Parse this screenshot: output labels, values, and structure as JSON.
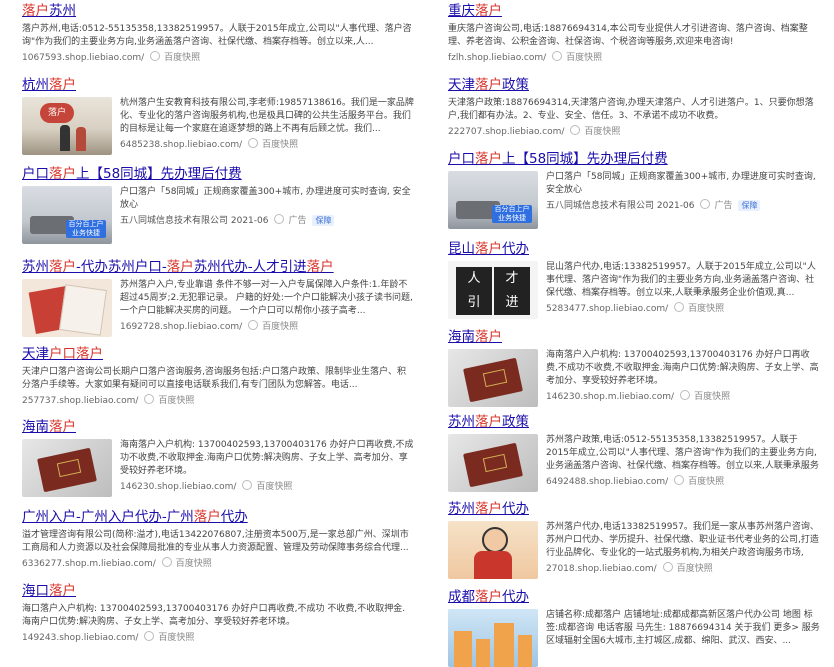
{
  "left": [
    {
      "title_segments": [
        {
          "t": "落户",
          "hl": true
        },
        {
          "t": "苏州",
          "hl": false
        }
      ],
      "snippet_segments": [
        {
          "t": "落户",
          "hl": true
        },
        {
          "t": "苏州,电话:0512-55135358,13382519957。人联于2015年成立,公司以\"人事代理、",
          "hl": false
        },
        {
          "t": "落户",
          "hl": true
        },
        {
          "t": "咨询\"作为我们的主要业务方向,业务涵盖",
          "hl": false
        },
        {
          "t": "落户",
          "hl": true
        },
        {
          "t": "咨询、社保代缴、档案存档等。创立以来,人...",
          "hl": false
        }
      ],
      "url": "1067593.shop.liebiao.com/",
      "snapshot": "百度快照"
    },
    {
      "title_segments": [
        {
          "t": "杭州",
          "hl": false
        },
        {
          "t": "落户",
          "hl": true
        }
      ],
      "thumb": "office",
      "thumb_text": "落户",
      "snippet_segments": [
        {
          "t": "杭州",
          "hl": false
        },
        {
          "t": "落户",
          "hl": true
        },
        {
          "t": "生安教育科技有限公司,李老师:19857138616。我们是一家品牌化、专业化的",
          "hl": false
        },
        {
          "t": "落户",
          "hl": true
        },
        {
          "t": "咨询服务机构,也是极具口碑的公共生活服务平台。我们的目标是让每一个家庭在追逐梦想的路上不再有后顾之忧。我们...",
          "hl": false
        }
      ],
      "url": "6485238.shop.liebiao.com/",
      "snapshot": "百度快照"
    },
    {
      "title_segments": [
        {
          "t": "户口",
          "hl": false
        },
        {
          "t": "落户",
          "hl": true
        },
        {
          "t": "上【58同城】先办理后付费",
          "hl": false
        }
      ],
      "thumb": "room",
      "thumb_text": "百分百上户 业务快捷",
      "snippet_segments": [
        {
          "t": "户口",
          "hl": false
        },
        {
          "t": "落户",
          "hl": true
        },
        {
          "t": "「58同城」正规商家覆盖300+城市, 办理进度可实时查询, 安全放心",
          "hl": false
        }
      ],
      "sub": "五八同城信息技术有限公司 2021-06",
      "ad": "广告",
      "guard": "保障"
    },
    {
      "title_segments": [
        {
          "t": "苏州",
          "hl": false
        },
        {
          "t": "落户",
          "hl": true
        },
        {
          "t": "-代办苏州户口-",
          "hl": false
        },
        {
          "t": "落户",
          "hl": true
        },
        {
          "t": "苏州代办-人才引进",
          "hl": false
        },
        {
          "t": "落户",
          "hl": true
        }
      ],
      "thumb": "docs",
      "snippet_segments": [
        {
          "t": "苏州",
          "hl": false
        },
        {
          "t": "落户",
          "hl": true
        },
        {
          "t": "入户,专业靠谱 条件不够一对一入户专属保障入户条件:1.年龄不超过45周岁;2.无犯罪记录。 户籍的好处:一个户口能解决小孩子读书问题,一个户口能解决买房的问题。 一个户口可以帮你小孩子高考...",
          "hl": false
        }
      ],
      "url": "1692728.shop.liebiao.com/",
      "snapshot": "百度快照"
    },
    {
      "title_segments": [
        {
          "t": "天津",
          "hl": false
        },
        {
          "t": "户口落户",
          "hl": true
        }
      ],
      "snippet_segments": [
        {
          "t": "天津户口",
          "hl": false
        },
        {
          "t": "落户",
          "hl": true
        },
        {
          "t": "咨询公司长期户口",
          "hl": false
        },
        {
          "t": "落户",
          "hl": true
        },
        {
          "t": "咨询服务,咨询服务包括:户口",
          "hl": false
        },
        {
          "t": "落户",
          "hl": true
        },
        {
          "t": "政策、限制毕业生",
          "hl": false
        },
        {
          "t": "落户",
          "hl": true
        },
        {
          "t": "、积分",
          "hl": false
        },
        {
          "t": "落户",
          "hl": true
        },
        {
          "t": "手续等。大家如果有疑问可以直接电话联系我们,有专门团队为您解答。电话...",
          "hl": false
        }
      ],
      "url": "257737.shop.liebiao.com/",
      "snapshot": "百度快照"
    },
    {
      "title_segments": [
        {
          "t": "海南",
          "hl": false
        },
        {
          "t": "落户",
          "hl": true
        }
      ],
      "thumb": "book",
      "snippet_segments": [
        {
          "t": "海南",
          "hl": false
        },
        {
          "t": "落户",
          "hl": true
        },
        {
          "t": "入户机构: 13700402593,13700403176 办好户口再收费,不成功不收费,不收取押金.海南户口优势:解决购房、子女上学、高考加分、享受较好养老环境。",
          "hl": false
        }
      ],
      "url": "146230.shop.liebiao.com/",
      "snapshot": "百度快照"
    },
    {
      "title_segments": [
        {
          "t": "广州入户-广州入户代办-广州",
          "hl": false
        },
        {
          "t": "落户",
          "hl": true
        },
        {
          "t": "代办",
          "hl": false
        }
      ],
      "snippet_segments": [
        {
          "t": "溢才管理咨询有限公司(简称:溢才),电话13422076807,注册资本500万,是一家总部广州、深圳市工商局和人力资源以及社会保障局批准的专业从事人力资源配置、管理及劳动保障事务综合代理...",
          "hl": false
        }
      ],
      "url": "6336277.shop.m.liebiao.com/",
      "snapshot": "百度快照"
    },
    {
      "title_segments": [
        {
          "t": "海口",
          "hl": false
        },
        {
          "t": "落户",
          "hl": true
        }
      ],
      "snippet_segments": [
        {
          "t": "海口",
          "hl": false
        },
        {
          "t": "落户",
          "hl": true
        },
        {
          "t": "入户机构: 13700402593,13700403176 办好户口再收费,不成功 不收费,不收取押金.海南户口优势:解决购房、子女上学、高考加分、享受较好养老环境。",
          "hl": false
        }
      ],
      "url": "149243.shop.liebiao.com/",
      "snapshot": "百度快照"
    }
  ],
  "right": [
    {
      "title_segments": [
        {
          "t": "重庆",
          "hl": false
        },
        {
          "t": "落户",
          "hl": true
        }
      ],
      "snippet_segments": [
        {
          "t": "重庆",
          "hl": false
        },
        {
          "t": "落户",
          "hl": true
        },
        {
          "t": "咨询公司,电话:18876694314,本公司专业提供人才引进咨询、",
          "hl": false
        },
        {
          "t": "落户",
          "hl": true
        },
        {
          "t": "咨询、档案整理、养老咨询、公积金咨询、社保咨询、个税咨询等服务,欢迎来电咨询!",
          "hl": false
        }
      ],
      "url": "fzlh.shop.liebiao.com/",
      "snapshot": "百度快照"
    },
    {
      "title_segments": [
        {
          "t": "天津",
          "hl": false
        },
        {
          "t": "落户",
          "hl": true
        },
        {
          "t": "政策",
          "hl": false
        }
      ],
      "snippet_segments": [
        {
          "t": "天津",
          "hl": false
        },
        {
          "t": "落户",
          "hl": true
        },
        {
          "t": "政策:18876694314,天津",
          "hl": false
        },
        {
          "t": "落户",
          "hl": true
        },
        {
          "t": "咨询,办理天津",
          "hl": false
        },
        {
          "t": "落户",
          "hl": true
        },
        {
          "t": "、人才引进",
          "hl": false
        },
        {
          "t": "落户",
          "hl": true
        },
        {
          "t": "。1、只要你想",
          "hl": false
        },
        {
          "t": "落户",
          "hl": true
        },
        {
          "t": ",我们都有办法。2、专业、安全、信任。3、不承诺不成功不收费。",
          "hl": false
        }
      ],
      "url": "222707.shop.liebiao.com/",
      "snapshot": "百度快照"
    },
    {
      "title_segments": [
        {
          "t": "户口",
          "hl": false
        },
        {
          "t": "落户",
          "hl": true
        },
        {
          "t": "上【58同城】先办理后付费",
          "hl": false
        }
      ],
      "thumb": "room",
      "thumb_text": "百分百上户 业务快捷",
      "snippet_segments": [
        {
          "t": "户口",
          "hl": false
        },
        {
          "t": "落户",
          "hl": true
        },
        {
          "t": "「58同城」正规商家覆盖300+城市, 办理进度可实时查询, 安全放心",
          "hl": false
        }
      ],
      "sub": "五八同城信息技术有限公司 2021-06",
      "ad": "广告",
      "guard": "保障"
    },
    {
      "title_segments": [
        {
          "t": "昆山",
          "hl": false
        },
        {
          "t": "落户",
          "hl": true
        },
        {
          "t": "代办",
          "hl": false
        }
      ],
      "thumb": "talent",
      "thumb_text": [
        "人",
        "才",
        "引",
        "进"
      ],
      "snippet_segments": [
        {
          "t": "昆山",
          "hl": false
        },
        {
          "t": "落户",
          "hl": true
        },
        {
          "t": "代办,电话:13382519957。人联于2015年成立,公司以\"人事代理、",
          "hl": false
        },
        {
          "t": "落户",
          "hl": true
        },
        {
          "t": "咨询\"作为我们的主要业务方向,业务涵盖",
          "hl": false
        },
        {
          "t": "落户",
          "hl": true
        },
        {
          "t": "咨询、社保代缴、档案存档等。创立以来,人联秉承服务企业价值观,真...",
          "hl": false
        }
      ],
      "url": "5283477.shop.liebiao.com/",
      "snapshot": "百度快照"
    },
    {
      "title_segments": [
        {
          "t": "海南",
          "hl": false
        },
        {
          "t": "落户",
          "hl": true
        }
      ],
      "thumb": "book",
      "snippet_segments": [
        {
          "t": "海南",
          "hl": false
        },
        {
          "t": "落户",
          "hl": true
        },
        {
          "t": "入户机构: 13700402593,13700403176 办好户口再收费,不成功不收费,不收取押金.海南户口优势:解决购房、子女上学、高考加分、享受较好养老环境。",
          "hl": false
        }
      ],
      "url": "146230.shop.m.liebiao.com/",
      "snapshot": "百度快照"
    },
    {
      "title_segments": [
        {
          "t": "苏州",
          "hl": false
        },
        {
          "t": "落户",
          "hl": true
        },
        {
          "t": "政策",
          "hl": false
        }
      ],
      "thumb": "book",
      "snippet_segments": [
        {
          "t": "苏州",
          "hl": false
        },
        {
          "t": "落户",
          "hl": true
        },
        {
          "t": "政策,电话:0512-55135358,13382519957。人联于2015年成立,公司以\"人事代理、",
          "hl": false
        },
        {
          "t": "落户",
          "hl": true
        },
        {
          "t": "咨询\"作为我们的主要业务方向,业务涵盖",
          "hl": false
        },
        {
          "t": "落户",
          "hl": true
        },
        {
          "t": "咨询、社保代缴、档案存档等。创立以来,人联秉承服务企业价...",
          "hl": false
        }
      ],
      "url": "6492488.shop.liebiao.com/",
      "snapshot": "百度快照"
    },
    {
      "title_segments": [
        {
          "t": "苏州",
          "hl": false
        },
        {
          "t": "落户",
          "hl": true
        },
        {
          "t": "代办",
          "hl": false
        }
      ],
      "thumb": "person",
      "snippet_segments": [
        {
          "t": "苏州",
          "hl": false
        },
        {
          "t": "落户",
          "hl": true
        },
        {
          "t": "代办,电话13382519957。我们是一家从事苏州",
          "hl": false
        },
        {
          "t": "落户",
          "hl": true
        },
        {
          "t": "咨询、苏州户口代办、学历提升、社保代缴、职业证书代考业务的公司,打造行业品牌化、专业化的一站式服务机构,为相关户政咨询服务市场,打...",
          "hl": false
        }
      ],
      "url": "27018.shop.liebiao.com/",
      "snapshot": "百度快照"
    },
    {
      "title_segments": [
        {
          "t": "成都",
          "hl": false
        },
        {
          "t": "落户",
          "hl": true
        },
        {
          "t": "代办",
          "hl": false
        }
      ],
      "thumb": "city",
      "snippet_segments": [
        {
          "t": "店铺名称:成都",
          "hl": false
        },
        {
          "t": "落户",
          "hl": true
        },
        {
          "t": " 店铺地址:成都成都高新区",
          "hl": false
        },
        {
          "t": "落户",
          "hl": true
        },
        {
          "t": "代办公司 地图 标签:成都咨询 电话客服 马先生: 18876694314 关于我们 更多> 服务区域辐射全国6大城市,主打城区,成都、绵阳、武汉、西安、...",
          "hl": false
        }
      ]
    }
  ],
  "colors": {
    "link": "#1a0dab",
    "highlight": "#d9342b",
    "text": "#444444"
  }
}
